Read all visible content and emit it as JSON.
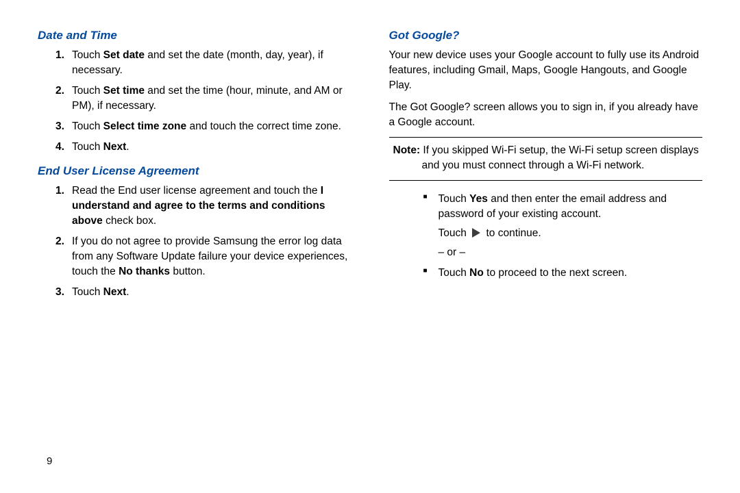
{
  "left": {
    "h1": "Date and Time",
    "steps1": [
      {
        "pre": "Touch ",
        "bold": "Set date",
        "post": " and set the date (month, day, year), if necessary."
      },
      {
        "pre": "Touch ",
        "bold": "Set time",
        "post": " and set the time (hour, minute, and AM or PM), if necessary."
      },
      {
        "pre": "Touch ",
        "bold": "Select time zone",
        "post": " and touch the correct time zone."
      },
      {
        "pre": "Touch ",
        "bold": "Next",
        "post": "."
      }
    ],
    "h2": "End User License Agreement",
    "steps2": [
      {
        "pre": "Read the End user license agreement and touch the ",
        "bold": "I understand and agree to the terms and conditions above",
        "post": " check box."
      },
      {
        "pre": "If you do not agree to provide Samsung the error log data from any Software Update failure your device experiences, touch the ",
        "bold": "No thanks",
        "post": " button."
      },
      {
        "pre": "Touch ",
        "bold": "Next",
        "post": "."
      }
    ]
  },
  "right": {
    "h1": "Got Google?",
    "p1": "Your new device uses your Google account to fully use its Android features, including Gmail, Maps, Google Hangouts, and Google Play.",
    "p2": "The Got Google? screen allows you to sign in, if you already have a Google account.",
    "note_label": "Note:",
    "note_body": " If you skipped Wi-Fi setup, the Wi-Fi setup screen displays and you must connect through a Wi-Fi network.",
    "bullet1_pre": "Touch ",
    "bullet1_bold": "Yes",
    "bullet1_post": " and then enter the email address and password of your existing account.",
    "touch_pre": "Touch ",
    "touch_post": " to continue.",
    "or": "– or –",
    "bullet2_pre": "Touch ",
    "bullet2_bold": "No",
    "bullet2_post": " to proceed to the next screen."
  },
  "page": "9"
}
